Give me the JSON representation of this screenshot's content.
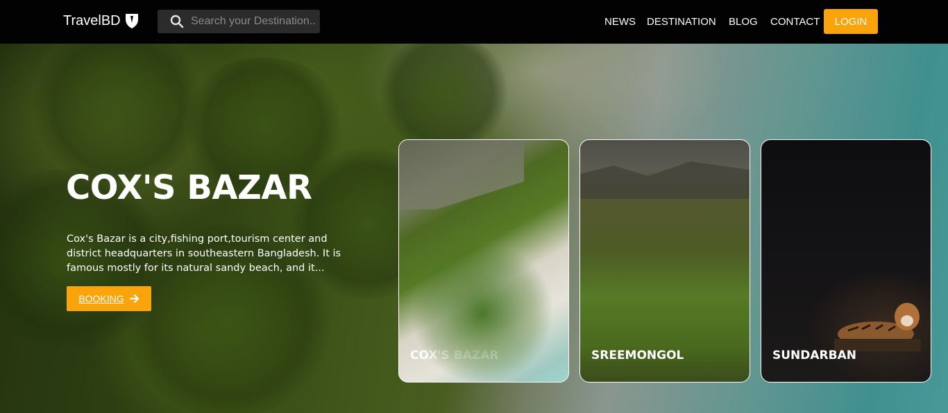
{
  "header": {
    "logo_text": "TravelBD",
    "search_placeholder": "Search your Destination...",
    "nav": [
      {
        "label": "NEWS"
      },
      {
        "label": "DESTINATION"
      },
      {
        "label": "BLOG"
      },
      {
        "label": "CONTACT"
      }
    ],
    "login_label": "LOGIN"
  },
  "hero": {
    "title": "COX'S BAZAR",
    "description": "Cox's Bazar is a city,fishing port,tourism center and district headquarters in southeastern Bangladesh. It is famous mostly for its natural sandy beach, and it...",
    "booking_label": "BOOKING"
  },
  "cards": [
    {
      "label": "COX'S BAZAR"
    },
    {
      "label": "SREEMONGOL"
    },
    {
      "label": "SUNDARBAN"
    }
  ],
  "colors": {
    "accent": "#f9a40a",
    "header_bg": "#020202"
  }
}
